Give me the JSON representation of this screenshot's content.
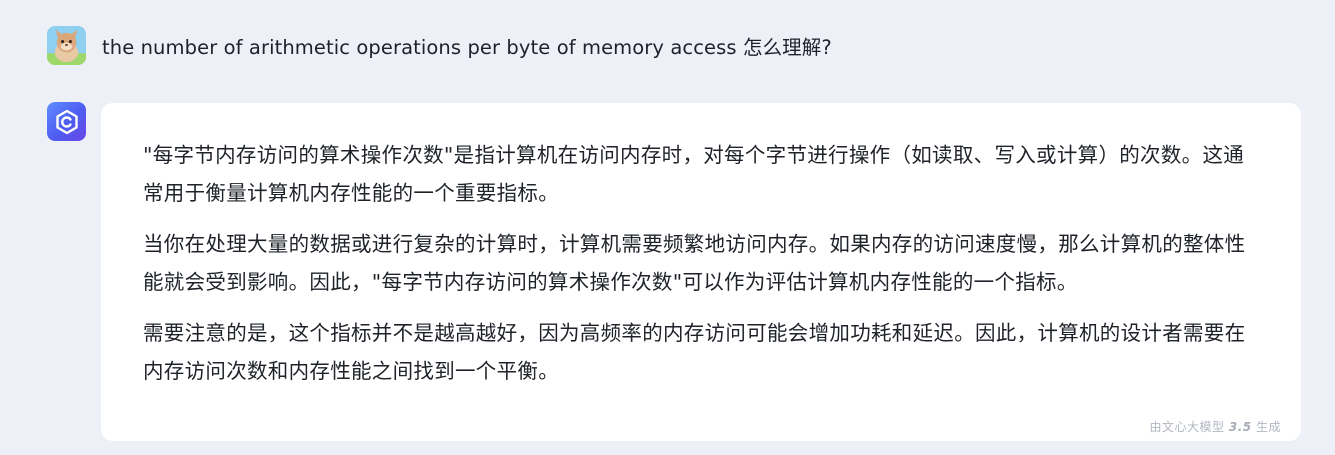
{
  "conversation": {
    "user_message": "the number of arithmetic operations per byte of memory access 怎么理解?",
    "bot_response": {
      "paragraphs": [
        "\"每字节内存访问的算术操作次数\"是指计算机在访问内存时，对每个字节进行操作（如读取、写入或计算）的次数。这通常用于衡量计算机内存性能的一个重要指标。",
        "当你在处理大量的数据或进行复杂的计算时，计算机需要频繁地访问内存。如果内存的访问速度慢，那么计算机的整体性能就会受到影响。因此，\"每字节内存访问的算术操作次数\"可以作为评估计算机内存性能的一个指标。",
        "需要注意的是，这个指标并不是越高越好，因为高频率的内存访问可能会增加功耗和延迟。因此，计算机的设计者需要在内存访问次数和内存性能之间找到一个平衡。"
      ],
      "model_badge": {
        "prefix": "由文心大模型",
        "version": "3.5",
        "suffix": "生成"
      }
    }
  },
  "icons": {
    "user_avatar": "cartoon-cat-avatar-icon",
    "bot_avatar": "ernie-bot-logo-icon"
  },
  "colors": {
    "page_background": "#eef0f7",
    "card_background": "#ffffff",
    "text": "#1f2329",
    "badge_text": "#b2b7c2",
    "bot_logo_gradient_start": "#5f8dff",
    "bot_logo_gradient_end": "#6b46e6"
  }
}
